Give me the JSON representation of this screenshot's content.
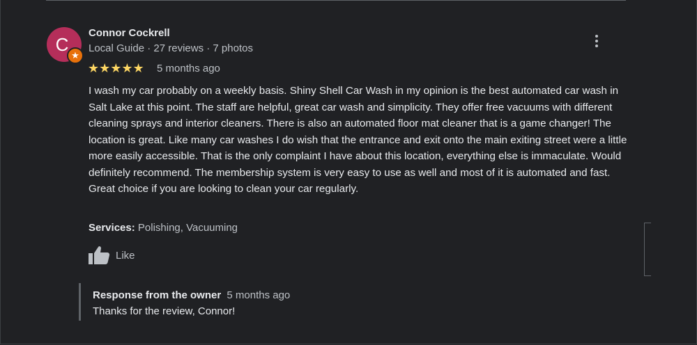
{
  "reviewer": {
    "avatar_letter": "C",
    "name": "Connor Cockrell",
    "meta": "Local Guide · 27 reviews · 7 photos",
    "badge_icon": "local-guide-star-icon"
  },
  "review": {
    "stars": "★★★★★",
    "rating": 5,
    "date": "5 months ago",
    "text": "I wash my car probably on a weekly basis. Shiny Shell Car Wash in my opinion is the best automated car wash in Salt Lake at this point. The staff are helpful, great car wash and simplicity. They offer free vacuums with different cleaning sprays and interior cleaners. There is also an automated floor mat cleaner that is a game changer! The location is great. Like many car washes I do wish that the entrance and exit onto the main exiting street were a little more easily accessible. That is the only complaint I have about this location, everything else is immaculate. Would definitely recommend. The membership system is very easy to use as well and most of it is automated and fast. Great choice if you are looking to clean your car regularly.",
    "services_label": "Services:",
    "services_value": "Polishing, Vacuuming",
    "like_label": "Like"
  },
  "owner_response": {
    "title": "Response from the owner",
    "date": "5 months ago",
    "text": "Thanks for the review, Connor!"
  },
  "colors": {
    "background": "#202124",
    "avatar": "#b52e5a",
    "star": "#fdd663",
    "badge": "#e8710a"
  }
}
